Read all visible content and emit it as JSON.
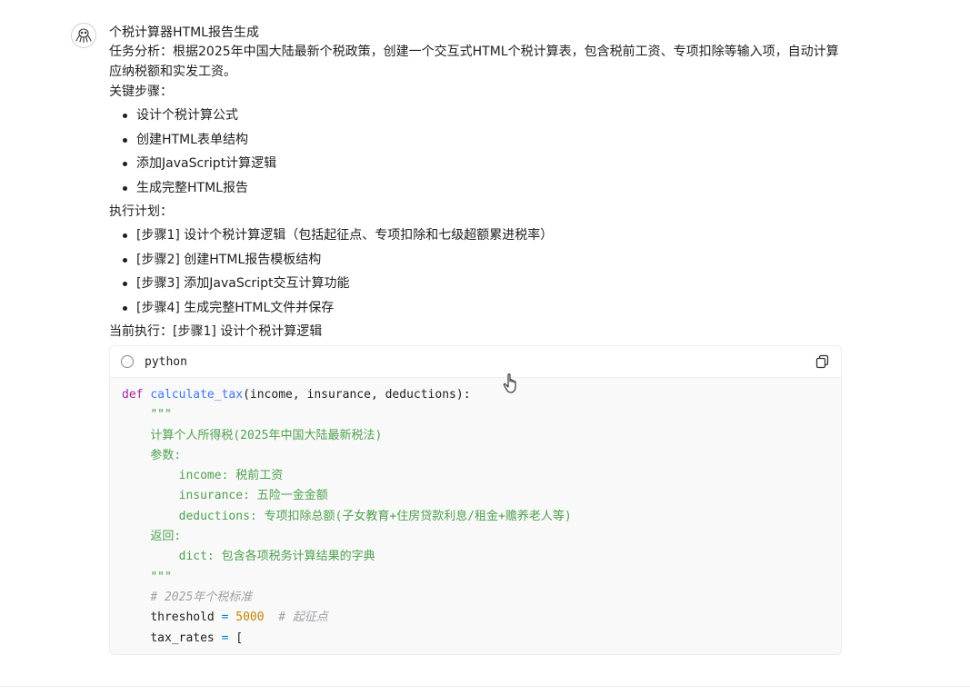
{
  "message": {
    "title": "个税计算器HTML报告生成",
    "task_analysis": "任务分析：根据2025年中国大陆最新个税政策，创建一个交互式HTML个税计算表，包含税前工资、专项扣除等输入项，自动计算应纳税额和实发工资。",
    "key_steps_label": "关键步骤：",
    "key_steps": [
      "设计个税计算公式",
      "创建HTML表单结构",
      "添加JavaScript计算逻辑",
      "生成完整HTML报告"
    ],
    "plan_label": "执行计划：",
    "plan": [
      "[步骤1] 设计个税计算逻辑（包括起征点、专项扣除和七级超额累进税率）",
      "[步骤2] 创建HTML报告模板结构",
      "[步骤3] 添加JavaScript交互计算功能",
      "[步骤4] 生成完整HTML文件并保存"
    ],
    "current": "当前执行：[步骤1] 设计个税计算逻辑"
  },
  "code_block": {
    "language": "python",
    "lines": {
      "def_kw": "def",
      "fn_name": "calculate_tax",
      "fn_args": "(income, insurance, deductions):",
      "doc_open": "\"\"\"",
      "doc_line1": "计算个人所得税(2025年中国大陆最新税法)",
      "doc_params": "参数:",
      "doc_income": "income: 税前工资",
      "doc_insurance": "insurance: 五险一金金额",
      "doc_deductions": "deductions: 专项扣除总额(子女教育+住房贷款利息/租金+赡养老人等)",
      "doc_returns": "返回:",
      "doc_dict": "dict: 包含各项税务计算结果的字典",
      "doc_close": "\"\"\"",
      "comment_std": "# 2025年个税标准",
      "threshold_var": "threshold",
      "eq": "=",
      "threshold_val": "5000",
      "threshold_comment": "# 起征点",
      "tax_rates_var": "tax_rates",
      "bracket": "["
    }
  },
  "colors": {
    "keyword": "#a626a4",
    "function": "#4078f2",
    "string": "#50a14f",
    "comment": "#a0a1a7",
    "number": "#c18401"
  },
  "icons": {
    "avatar": "octopus-avatar-icon",
    "run": "run-circle-icon",
    "copy": "copy-icon",
    "cursor": "hand-cursor-icon"
  }
}
